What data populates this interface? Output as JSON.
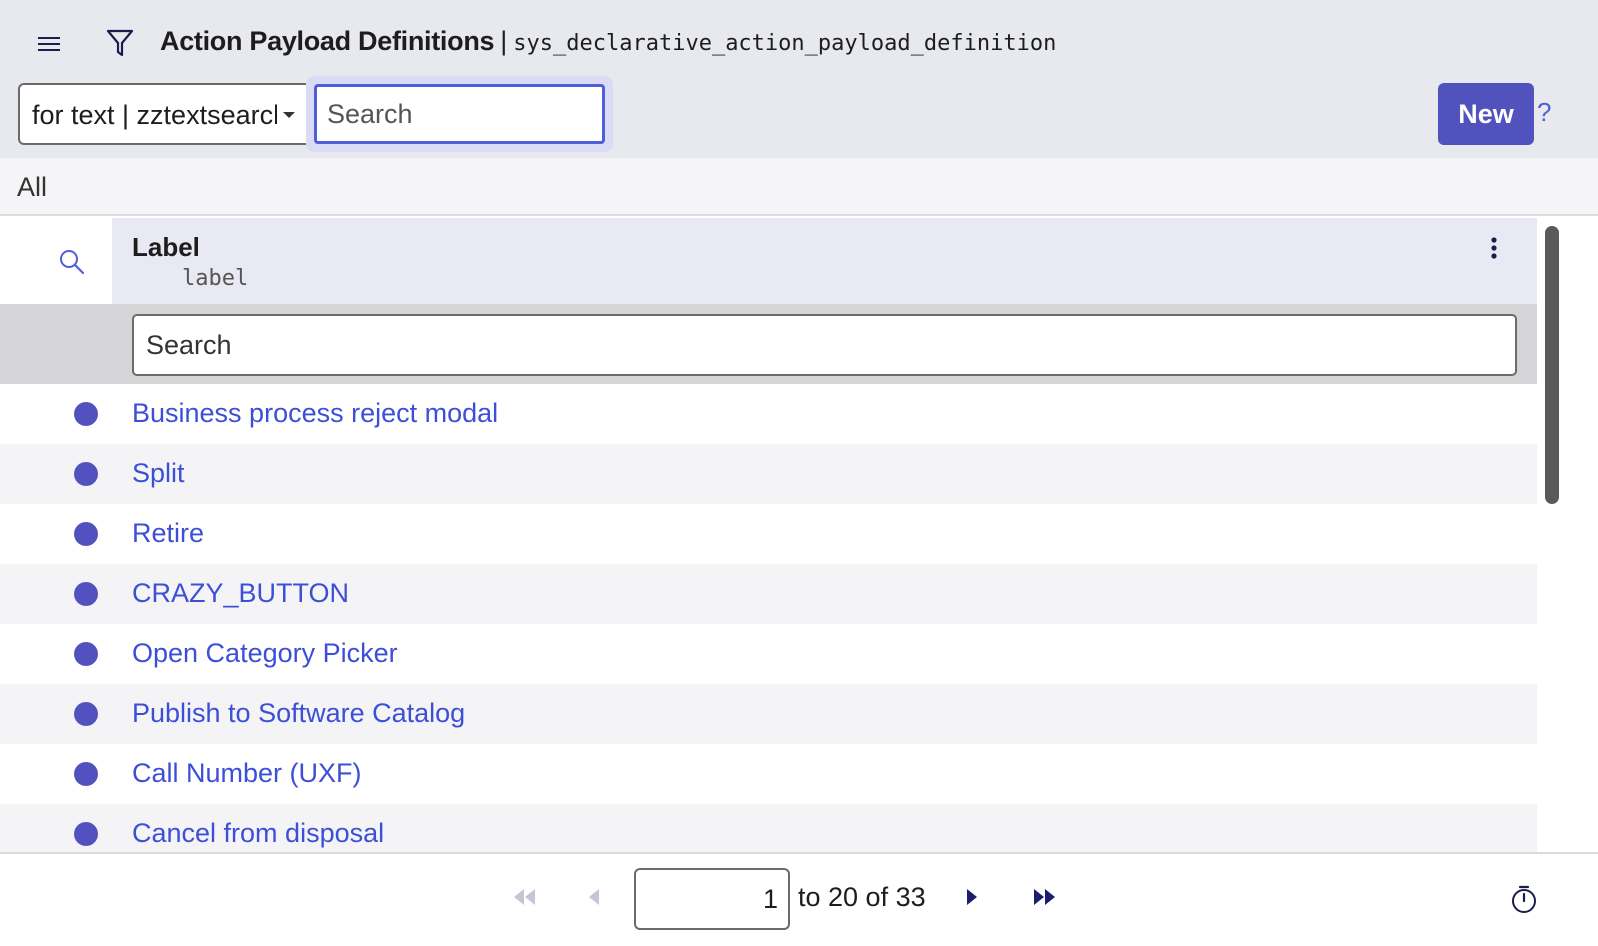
{
  "header": {
    "title": "Action Payload Definitions",
    "separator": "|",
    "table_name": "sys_declarative_action_payload_definition",
    "search_field_select": "for text | zztextsearchyh",
    "search_placeholder": "Search",
    "new_label": "New",
    "help_label": "?"
  },
  "breadcrumb": "All",
  "column": {
    "label": "Label",
    "field": "label",
    "filter_placeholder": "Search"
  },
  "rows": [
    "Business process reject modal",
    "Split",
    "Retire",
    "CRAZY_BUTTON",
    "Open Category Picker",
    "Publish to Software Catalog",
    "Call Number (UXF)",
    "Cancel from disposal"
  ],
  "pagination": {
    "current_page_value": "1",
    "range_text": "to 20 of 33"
  },
  "icons": {
    "menu": "hamburger-menu-icon",
    "filter": "funnel-filter-icon",
    "column_search": "magnifier-icon",
    "column_menu": "vertical-ellipsis-icon",
    "first": "double-chevron-left-icon",
    "prev": "chevron-left-icon",
    "next": "chevron-right-icon",
    "last": "double-chevron-right-icon",
    "timer": "stopwatch-icon"
  },
  "colors": {
    "accent": "#5252bf",
    "link": "#3c4fd6",
    "header_bg": "#e8e9ee"
  }
}
